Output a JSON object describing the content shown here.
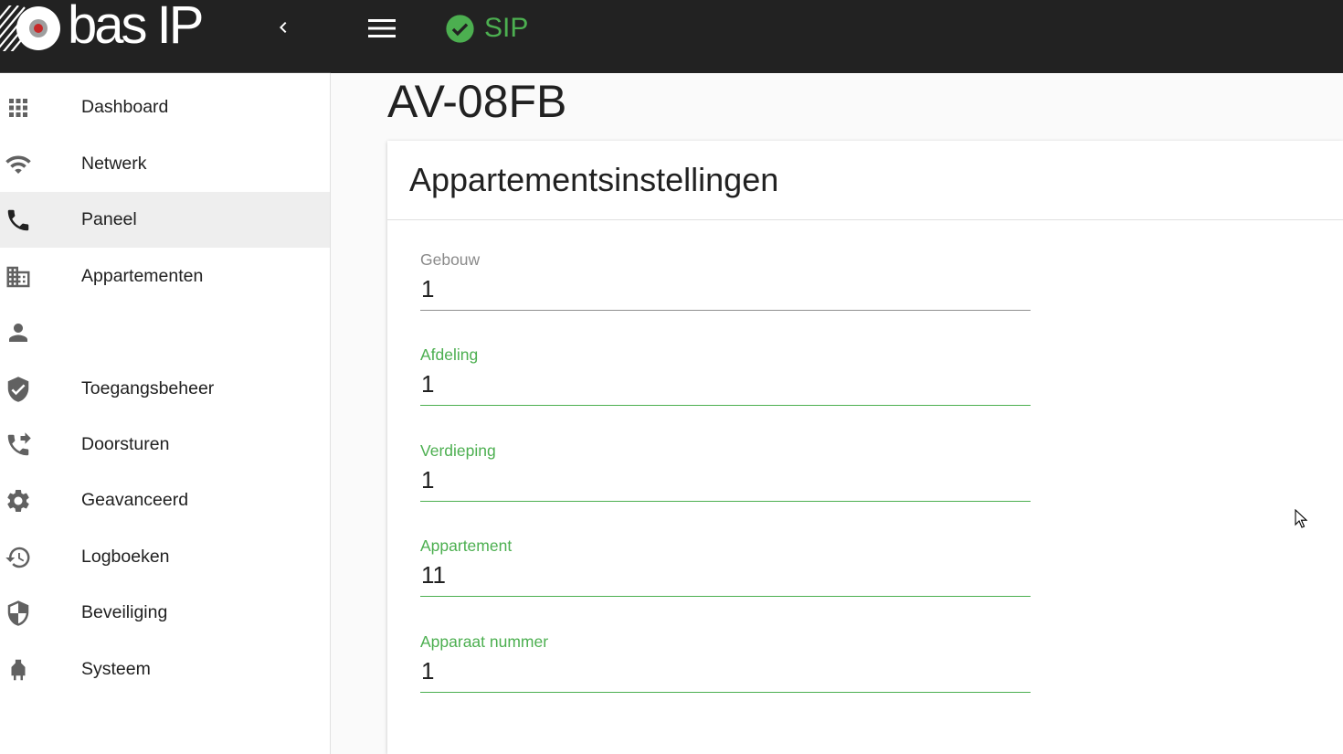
{
  "header": {
    "brand": "bas IP",
    "sip_label": "SIP",
    "colors": {
      "bar": "#222222",
      "accent": "#4caf50"
    }
  },
  "sidebar": {
    "items": [
      {
        "label": "Dashboard",
        "icon": "apps-grid-icon",
        "active": false
      },
      {
        "label": "Netwerk",
        "icon": "wifi-icon",
        "active": false
      },
      {
        "label": "Paneel",
        "icon": "phone-icon",
        "active": true
      },
      {
        "label": "Appartementen",
        "icon": "building-icon",
        "active": false
      },
      {
        "label": "",
        "icon": "person-icon",
        "active": false
      },
      {
        "label": "Toegangsbeheer",
        "icon": "shield-check-icon",
        "active": false
      },
      {
        "label": "Doorsturen",
        "icon": "phone-forward-icon",
        "active": false
      },
      {
        "label": "Geavanceerd",
        "icon": "gear-icon",
        "active": false
      },
      {
        "label": "Logboeken",
        "icon": "history-icon",
        "active": false
      },
      {
        "label": "Beveiliging",
        "icon": "security-shield-icon",
        "active": false
      },
      {
        "label": "Systeem",
        "icon": "plug-icon",
        "active": false
      }
    ]
  },
  "main": {
    "page_title": "AV-08FB",
    "card_title": "Appartementsinstellingen",
    "fields": [
      {
        "label": "Gebouw",
        "value": "1",
        "focused": false
      },
      {
        "label": "Afdeling",
        "value": "1",
        "focused": true
      },
      {
        "label": "Verdieping",
        "value": "1",
        "focused": true
      },
      {
        "label": "Appartement",
        "value": "11",
        "focused": true
      },
      {
        "label": "Apparaat nummer",
        "value": "1",
        "focused": true
      }
    ]
  }
}
